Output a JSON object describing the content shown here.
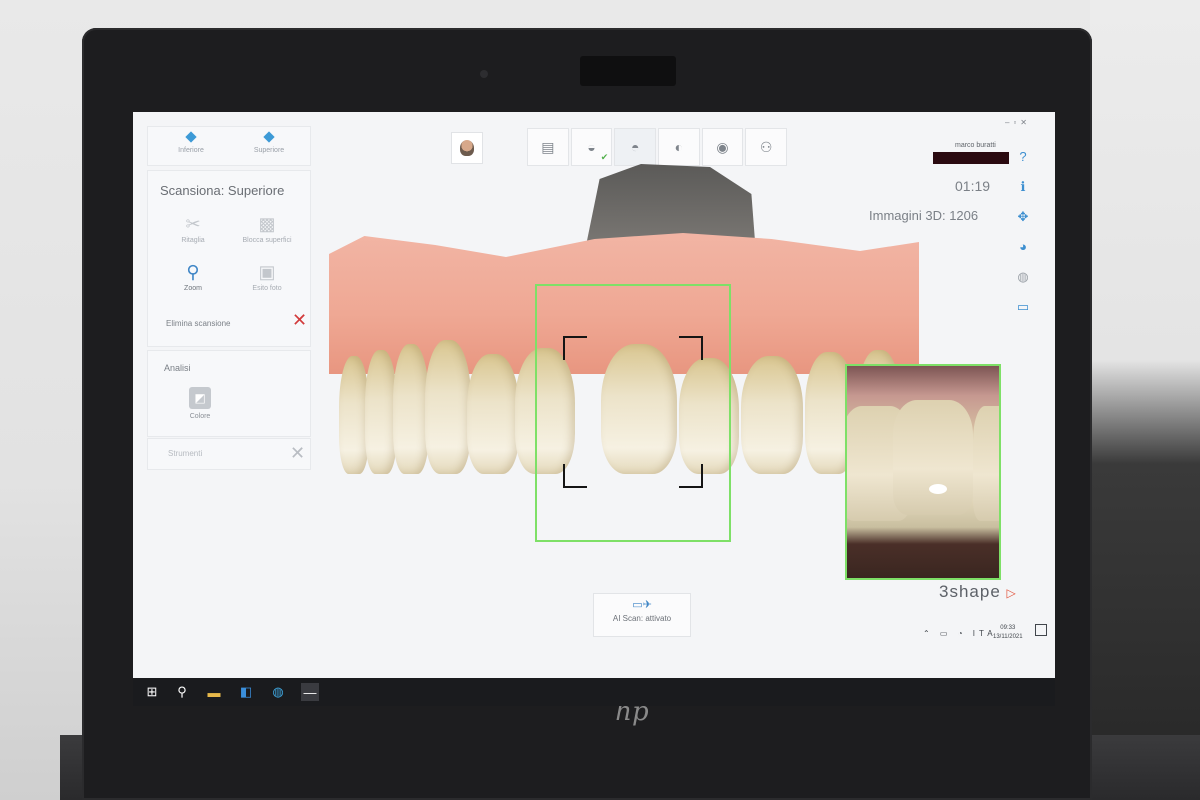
{
  "app": {
    "brand": "3shape",
    "user_name": "marco buratti",
    "timer": "01:19",
    "images_count": "Immagini 3D: 1206",
    "ai_scan": "AI Scan: attivato"
  },
  "left_panel": {
    "view_buttons": [
      {
        "label": "Inferiore",
        "icon": "diamond-icon"
      },
      {
        "label": "Superiore",
        "icon": "diamond-icon"
      }
    ],
    "scan_title": "Scansiona: Superiore",
    "tools": [
      {
        "label": "Ritaglia",
        "icon": "scissors-icon"
      },
      {
        "label": "Blocca superfici",
        "icon": "lock-surface-icon"
      },
      {
        "label": "Zoom",
        "icon": "magnifier-icon"
      },
      {
        "label": "Esito foto",
        "icon": "photo-icon"
      }
    ],
    "delete_scan": "Elimina scansione",
    "analysis_title": "Analisi",
    "color_tool": "Colore",
    "instruments": "Strumenti"
  },
  "workflow_steps": [
    {
      "name": "prescription",
      "icon": "clipboard-icon"
    },
    {
      "name": "upper-scan",
      "icon": "upper-jaw-icon",
      "done": true
    },
    {
      "name": "lower-scan",
      "icon": "lower-jaw-icon"
    },
    {
      "name": "bite-scan",
      "icon": "bite-icon"
    },
    {
      "name": "analysis",
      "icon": "sphere-icon"
    },
    {
      "name": "send",
      "icon": "people-icon"
    }
  ],
  "side_icons": [
    "help-icon",
    "info-icon",
    "move-icon",
    "color-wheel-icon",
    "tooth-icon",
    "chat-icon"
  ],
  "tray": {
    "lang": "ITA",
    "time": "09:33",
    "date": "13/11/2021"
  },
  "colors": {
    "scan_frame": "#7ee067",
    "delete": "#d23b3b",
    "accent": "#3f86c6",
    "brand_mark": "#e2533c"
  }
}
